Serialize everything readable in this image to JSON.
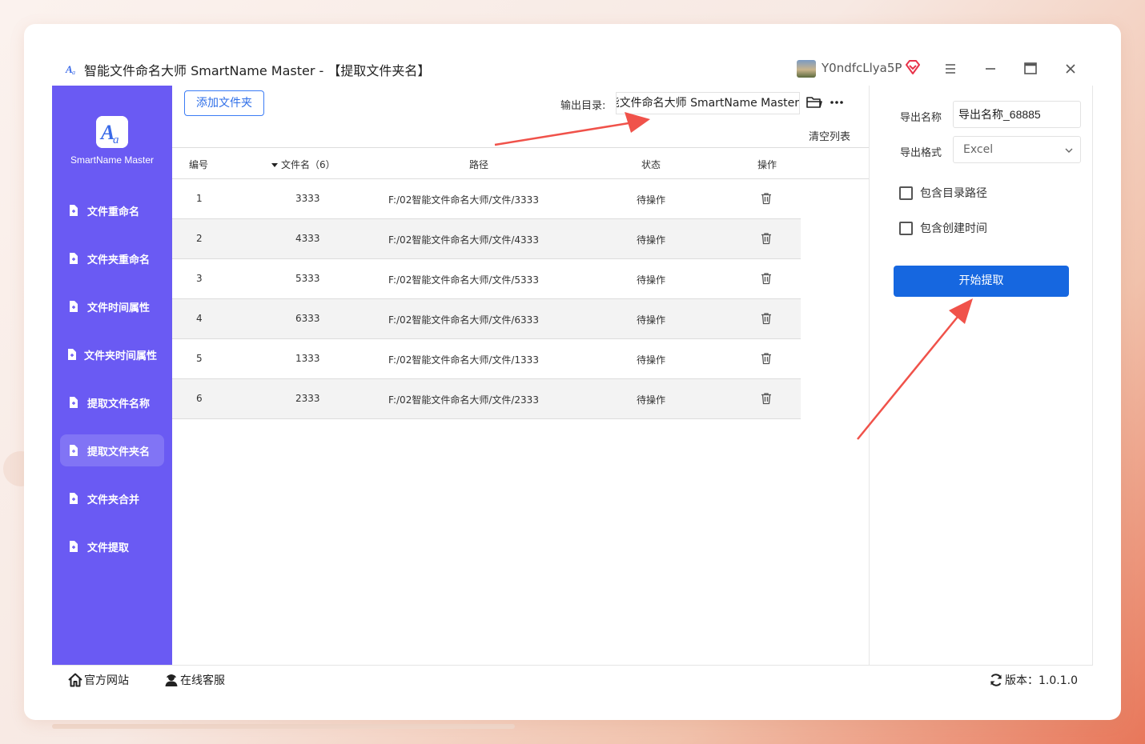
{
  "window": {
    "title": "智能文件命名大师 SmartName Master - 【提取文件夹名】",
    "username": "Y0ndfcLlya5P",
    "minimize_icon": "minimize-icon",
    "maximize_icon": "maximize-icon",
    "close_icon": "close-icon"
  },
  "sidebar": {
    "logo_text": "SmartName Master",
    "items": [
      {
        "label": "文件重命名"
      },
      {
        "label": "文件夹重命名"
      },
      {
        "label": "文件时间属性"
      },
      {
        "label": "文件夹时间属性"
      },
      {
        "label": "提取文件名称"
      },
      {
        "label": "提取文件夹名",
        "active": true
      },
      {
        "label": "文件夹合并"
      },
      {
        "label": "文件提取"
      }
    ]
  },
  "toolbar": {
    "add_folder_label": "添加文件夹",
    "output_label": "输出目录:",
    "output_path": "能文件命名大师 SmartName Master",
    "clear_list_label": "清空列表"
  },
  "table": {
    "headers": {
      "index": "编号",
      "name": "文件名（6）",
      "path": "路径",
      "status": "状态",
      "action": "操作"
    },
    "rows": [
      {
        "index": "1",
        "name": "3333",
        "path": "F:/02智能文件命名大师/文件/3333",
        "status": "待操作"
      },
      {
        "index": "2",
        "name": "4333",
        "path": "F:/02智能文件命名大师/文件/4333",
        "status": "待操作"
      },
      {
        "index": "3",
        "name": "5333",
        "path": "F:/02智能文件命名大师/文件/5333",
        "status": "待操作"
      },
      {
        "index": "4",
        "name": "6333",
        "path": "F:/02智能文件命名大师/文件/6333",
        "status": "待操作"
      },
      {
        "index": "5",
        "name": "1333",
        "path": "F:/02智能文件命名大师/文件/1333",
        "status": "待操作"
      },
      {
        "index": "6",
        "name": "2333",
        "path": "F:/02智能文件命名大师/文件/2333",
        "status": "待操作"
      }
    ]
  },
  "right_panel": {
    "export_name_label": "导出名称",
    "export_name_value": "导出名称_68885",
    "export_format_label": "导出格式",
    "export_format_value": "Excel",
    "include_path_label": "包含目录路径",
    "include_path_checked": false,
    "include_time_label": "包含创建时间",
    "include_time_checked": false,
    "start_button_label": "开始提取"
  },
  "footer": {
    "website_label": "官方网站",
    "support_label": "在线客服",
    "version_label": "版本：1.0.1.0"
  },
  "colors": {
    "sidebar": "#6a5af3",
    "sidebar_active": "#8174f5",
    "primary_button": "#1667e0",
    "annotation_arrow": "#f0524a"
  }
}
